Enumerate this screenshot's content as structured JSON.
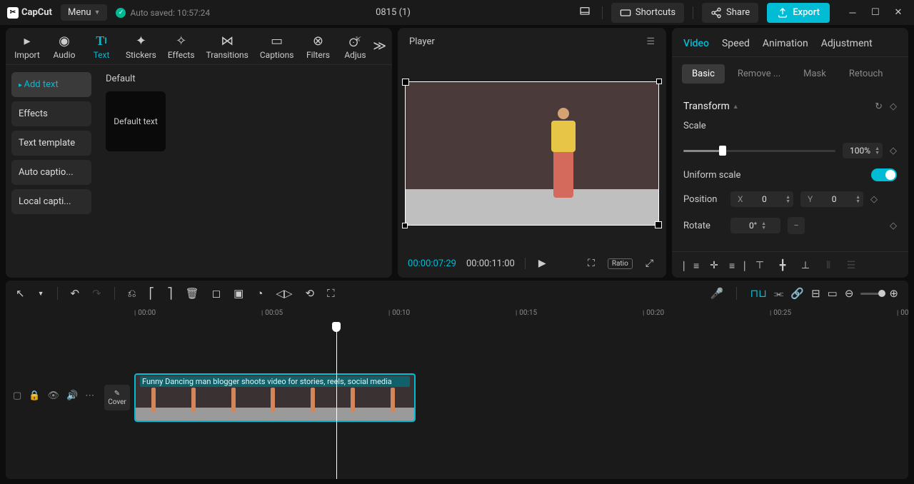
{
  "app": {
    "name": "CapCut",
    "menu": "Menu",
    "autosave": "Auto saved: 10:57:24",
    "project": "0815 (1)"
  },
  "topbar": {
    "shortcuts": "Shortcuts",
    "share": "Share",
    "export": "Export"
  },
  "mediaTabs": [
    "Import",
    "Audio",
    "Text",
    "Stickers",
    "Effects",
    "Transitions",
    "Captions",
    "Filters",
    "Adjus"
  ],
  "activeMediaTab": 2,
  "textSide": {
    "items": [
      "Add text",
      "Effects",
      "Text template",
      "Auto captio...",
      "Local capti..."
    ],
    "active": 0
  },
  "textContent": {
    "heading": "Default",
    "card": "Default text"
  },
  "player": {
    "title": "Player",
    "current": "00:00:07:29",
    "total": "00:00:11:00",
    "ratio": "Ratio"
  },
  "inspector": {
    "tabs": [
      "Video",
      "Speed",
      "Animation",
      "Adjustment"
    ],
    "activeTab": 0,
    "subtabs": [
      "Basic",
      "Remove ...",
      "Mask",
      "Retouch"
    ],
    "activeSub": 0,
    "transform": "Transform",
    "scale": {
      "label": "Scale",
      "value": "100%"
    },
    "uniform": "Uniform scale",
    "position": {
      "label": "Position",
      "x": "0",
      "y": "0"
    },
    "rotate": {
      "label": "Rotate",
      "value": "0°"
    }
  },
  "ruler": [
    "00:00",
    "00:05",
    "00:10",
    "00:15",
    "00:20",
    "00:25",
    "00:"
  ],
  "cover": "Cover",
  "clip": {
    "label": "Funny Dancing man blogger shoots video for stories, reels, social media"
  }
}
